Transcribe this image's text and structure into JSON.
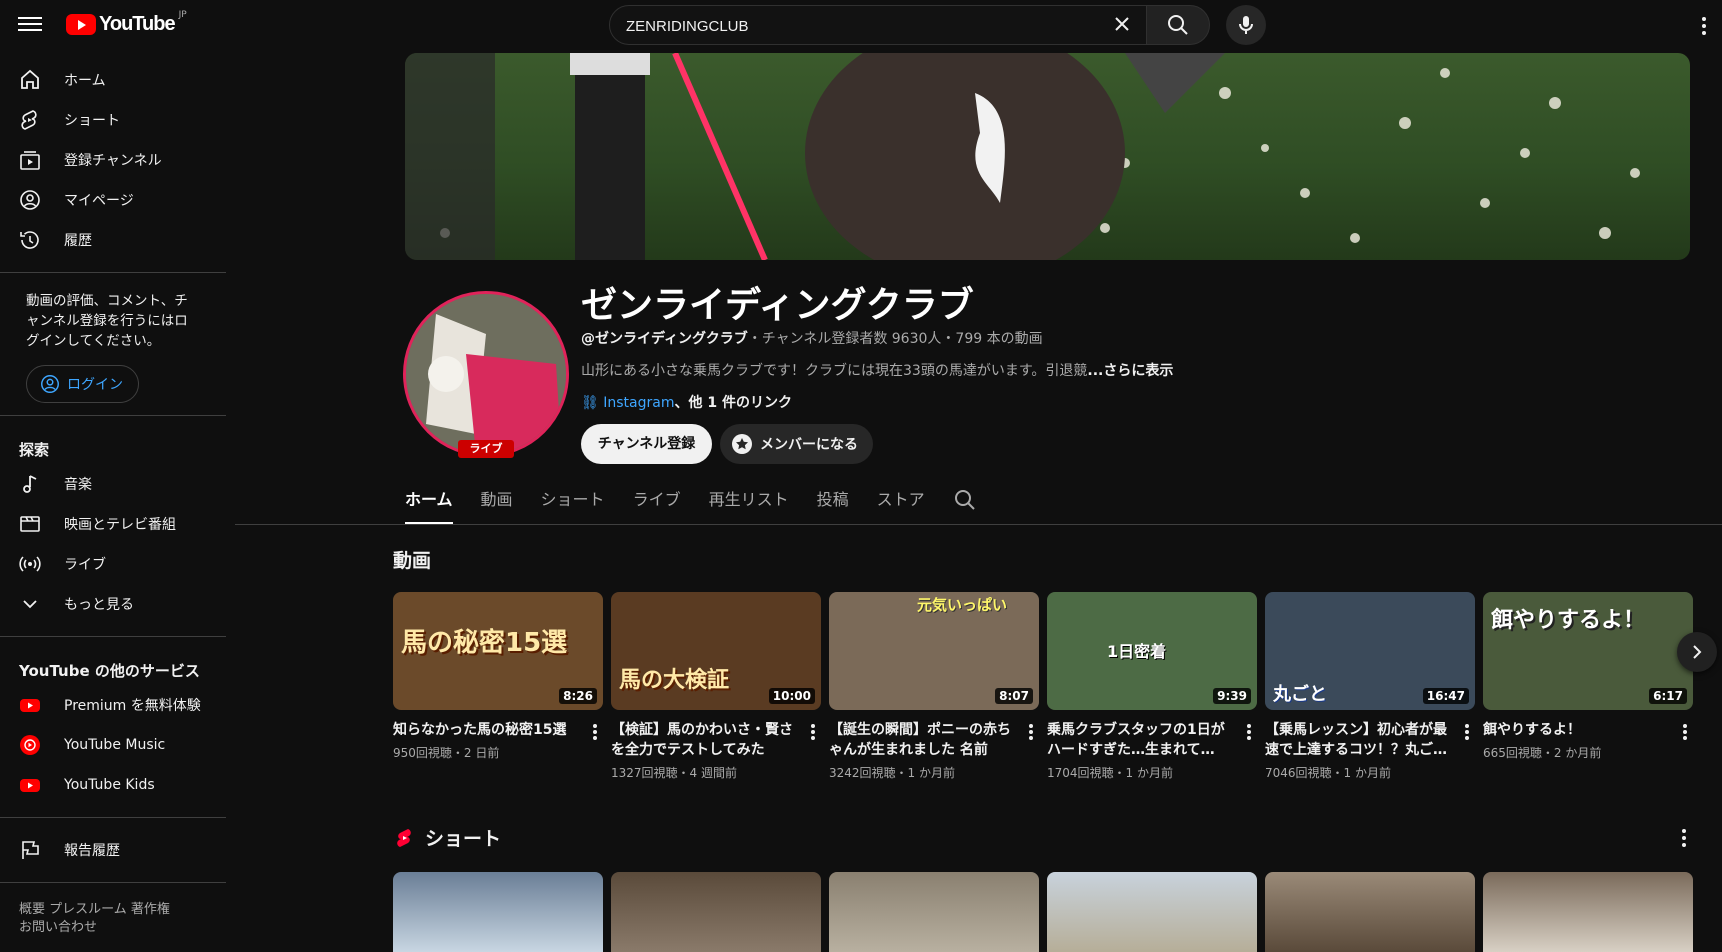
{
  "header": {
    "logo_text": "YouTube",
    "logo_region": "JP",
    "search_value": "ZENRIDINGCLUB"
  },
  "sidebar": {
    "main": [
      {
        "label": "ホーム",
        "icon": "home-icon"
      },
      {
        "label": "ショート",
        "icon": "shorts-icon"
      },
      {
        "label": "登録チャンネル",
        "icon": "subscriptions-icon"
      },
      {
        "label": "マイページ",
        "icon": "you-icon"
      },
      {
        "label": "履歴",
        "icon": "history-icon"
      }
    ],
    "signin_prompt": "動画の評価、コメント、チャンネル登録を行うにはログインしてください。",
    "login_label": "ログイン",
    "explore_title": "探索",
    "explore": [
      {
        "label": "音楽",
        "icon": "music-icon"
      },
      {
        "label": "映画とテレビ番組",
        "icon": "film-icon"
      },
      {
        "label": "ライブ",
        "icon": "live-icon"
      },
      {
        "label": "もっと見る",
        "icon": "chevron-down-icon"
      }
    ],
    "services_title": "YouTube の他のサービス",
    "services": [
      {
        "label": "Premium を無料体験",
        "icon": "youtube-premium-icon"
      },
      {
        "label": "YouTube Music",
        "icon": "youtube-music-icon"
      },
      {
        "label": "YouTube Kids",
        "icon": "youtube-kids-icon"
      }
    ],
    "report_history": "報告履歴",
    "footer_line1": "概要  プレスルーム  著作権",
    "footer_line2": "お問い合わせ"
  },
  "channel": {
    "name": "ゼンライディングクラブ",
    "handle": "@ゼンライディングクラブ",
    "meta": "・チャンネル登録者数 9630人・799 本の動画",
    "description": "山形にある小さな乗馬クラブです！クラブには現在33頭の馬達がいます。引退競",
    "more_label": "...さらに表示",
    "link_instagram": "Instagram",
    "link_other": "、他 1 件のリンク",
    "live_badge": "ライブ",
    "subscribe_label": "チャンネル登録",
    "member_label": "メンバーになる"
  },
  "tabs": [
    "ホーム",
    "動画",
    "ショート",
    "ライブ",
    "再生リスト",
    "投稿",
    "ストア"
  ],
  "videos_section_title": "動画",
  "videos": [
    {
      "title": "知らなかった馬の秘密15選",
      "meta": "950回視聴・2 日前",
      "duration": "8:26",
      "thumb_text": "馬の秘密15選",
      "color": "#6b4a2a"
    },
    {
      "title": "【検証】馬のかわいさ・賢さを全力でテストしてみた",
      "meta": "1327回視聴・4 週間前",
      "duration": "10:00",
      "thumb_text": "馬の大検証",
      "color": "#5a3b22"
    },
    {
      "title": "【誕生の瞬間】ポニーの赤ちゃんが生まれました 名前は…",
      "meta": "3242回視聴・1 か月前",
      "duration": "8:07",
      "thumb_text": "元気いっぱい",
      "color": "#7b6a58"
    },
    {
      "title": "乗馬クラブスタッフの1日がハードすぎた…生まれて…",
      "meta": "1704回視聴・1 か月前",
      "duration": "9:39",
      "thumb_text": "1日密着",
      "color": "#4d6b45"
    },
    {
      "title": "【乗馬レッスン】初心者が最速で上達するコツ！？丸ご…",
      "meta": "7046回視聴・1 か月前",
      "duration": "16:47",
      "thumb_text": "丸ごと",
      "color": "#3b4a5a"
    },
    {
      "title": "餌やりするよ！",
      "meta": "665回視聴・2 か月前",
      "duration": "6:17",
      "thumb_text": "餌やりするよ！",
      "color": "#4a5a3b"
    }
  ],
  "shorts_title": "ショート"
}
